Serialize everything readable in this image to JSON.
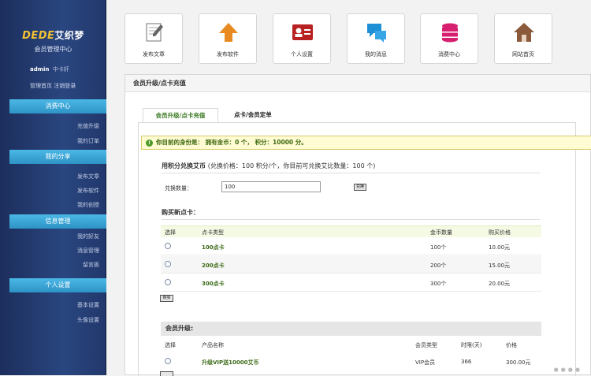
{
  "sidebar": {
    "logo_brand": "DEDE",
    "logo_text": "艾织梦",
    "logo_sub": "会员管理中心",
    "username": "admin",
    "user_role": "中卡奸",
    "top_links": "管理首页 注销登录",
    "sections": [
      {
        "title": "消费中心",
        "items": [
          "充值升级",
          "我的订单"
        ]
      },
      {
        "title": "我的分享",
        "items": [
          "发布文章",
          "发布软件",
          "我的创授"
        ]
      },
      {
        "title": "信息管理",
        "items": [
          "我的好友",
          "消息管理",
          "留言板"
        ]
      },
      {
        "title": "个人设置",
        "items": [
          "基本设置",
          "头像设置"
        ]
      }
    ]
  },
  "quick_buttons": [
    {
      "label": "发布文章",
      "icon": "edit-document-icon",
      "color": "#7a7a7a"
    },
    {
      "label": "发布软件",
      "icon": "upload-arrow-icon",
      "color": "#e88a1f"
    },
    {
      "label": "个人设置",
      "icon": "id-card-icon",
      "color": "#b82121"
    },
    {
      "label": "我的消息",
      "icon": "chat-bubbles-icon",
      "color": "#1e8fd4"
    },
    {
      "label": "消费中心",
      "icon": "database-icon",
      "color": "#d6206f"
    },
    {
      "label": "网站首页",
      "icon": "home-icon",
      "color": "#8a5a3a"
    }
  ],
  "panel": {
    "title": "会员升级/点卡充值",
    "tabs": [
      "会员升级/点卡充值",
      "点卡/会员定单"
    ],
    "notice": "你目前的身份是：  拥有金币：0 个，  积分：10000 分。",
    "exchange": {
      "title": "用积分兑换艾币",
      "note": "(兑换价格：100 积分/个，你目前可兑换艾比数量：100 个)",
      "label": "兑换数量：",
      "value": "100",
      "button": "兑换"
    },
    "cards": {
      "title": "购买新点卡：",
      "headers": [
        "选择",
        "点卡类型",
        "金币数量",
        "购买价格"
      ],
      "rows": [
        {
          "name": "100点卡",
          "qty": "100个",
          "price": "10.00元"
        },
        {
          "name": "200点卡",
          "qty": "200个",
          "price": "15.00元"
        },
        {
          "name": "300点卡",
          "qty": "300个",
          "price": "20.00元"
        }
      ],
      "button": "购买"
    },
    "vip": {
      "title": "会员升级:",
      "headers": [
        "选择",
        "产品名称",
        "会员类型",
        "时限(天)",
        "价格"
      ],
      "rows": [
        {
          "name": "升级VIP送10000艾币",
          "type": "VIP会员",
          "days": "366",
          "price": "300.00元"
        }
      ]
    }
  }
}
